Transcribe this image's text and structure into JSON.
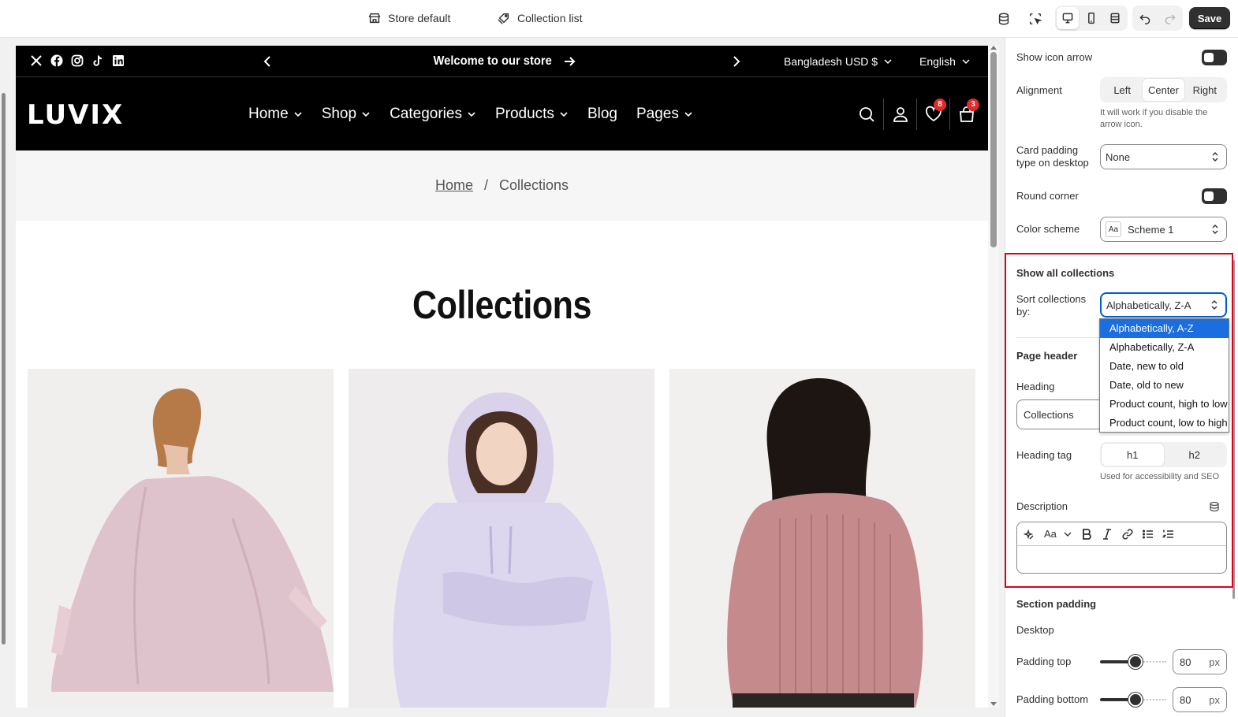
{
  "topbar": {
    "store_label": "Store default",
    "template_label": "Collection list",
    "save_label": "Save"
  },
  "announcement": {
    "text": "Welcome to our store",
    "currency": "Bangladesh USD $",
    "language": "English",
    "social": [
      "x-icon",
      "facebook-icon",
      "instagram-icon",
      "tiktok-icon",
      "linkedin-icon"
    ]
  },
  "nav": {
    "logo": "LUVIX",
    "menu": [
      "Home",
      "Shop",
      "Categories",
      "Products",
      "Blog",
      "Pages"
    ],
    "wishlist_count": "8",
    "cart_count": "3"
  },
  "breadcrumb": {
    "home": "Home",
    "separator": "/",
    "current": "Collections"
  },
  "page": {
    "title": "Collections"
  },
  "settings": {
    "show_icon_arrow": "Show icon arrow",
    "alignment_label": "Alignment",
    "alignment_options": [
      "Left",
      "Center",
      "Right"
    ],
    "alignment_selected": "Center",
    "alignment_help": "It will work if you disable the arrow icon.",
    "card_padding_label": "Card padding type on desktop",
    "card_padding_value": "None",
    "round_corner_label": "Round corner",
    "color_scheme_label": "Color scheme",
    "color_scheme_icon": "Aa",
    "color_scheme_value": "Scheme 1",
    "show_all_title": "Show all collections",
    "sort_label": "Sort collections by:",
    "sort_value": "Alphabetically, Z-A",
    "sort_options": [
      "Alphabetically, A-Z",
      "Alphabetically, Z-A",
      "Date, new to old",
      "Date, old to new",
      "Product count, high to low",
      "Product count, low to high"
    ],
    "page_header_title": "Page header",
    "heading_label": "Heading",
    "heading_value": "Collections",
    "heading_tag_label": "Heading tag",
    "heading_tag_options": [
      "h1",
      "h2"
    ],
    "heading_tag_help": "Used for accessibility and SEO",
    "description_label": "Description",
    "rte_font_label": "Aa",
    "section_padding_title": "Section padding",
    "desktop_label": "Desktop",
    "padding_top_label": "Padding top",
    "padding_top_value": "80",
    "padding_bottom_label": "Padding bottom",
    "padding_bottom_value": "80",
    "unit": "px"
  }
}
